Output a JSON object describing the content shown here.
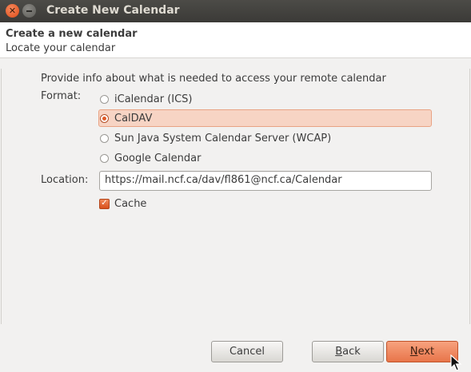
{
  "window": {
    "title": "Create New Calendar"
  },
  "header": {
    "title": "Create a new calendar",
    "subtitle": "Locate your calendar"
  },
  "form": {
    "intro": "Provide info about what is needed to access your remote calendar",
    "format_label": "Format:",
    "formats": [
      {
        "label": "iCalendar (ICS)",
        "selected": false
      },
      {
        "label": "CalDAV",
        "selected": true
      },
      {
        "label": "Sun Java System Calendar Server (WCAP)",
        "selected": false
      },
      {
        "label": "Google Calendar",
        "selected": false
      }
    ],
    "location_label": "Location:",
    "location_value": "https://mail.ncf.ca/dav/fl861@ncf.ca/Calendar",
    "cache_label": "Cache",
    "cache_checked": true
  },
  "buttons": {
    "cancel": "Cancel",
    "back_mnemonic": "B",
    "back_rest": "ack",
    "next_mnemonic": "N",
    "next_rest": "ext"
  },
  "colors": {
    "accent": "#e05a26",
    "selection": "#f7d4c4",
    "titlebar": "#3c3b37"
  }
}
